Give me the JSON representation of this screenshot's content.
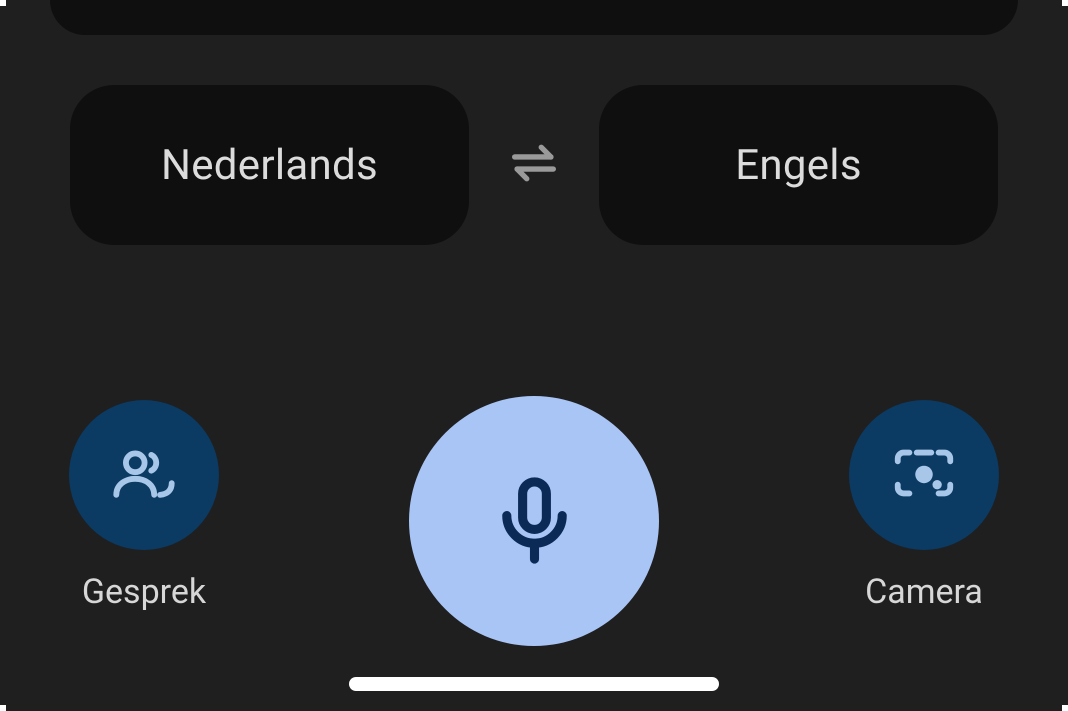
{
  "languages": {
    "source": "Nederlands",
    "target": "Engels"
  },
  "actions": {
    "conversation": "Gesprek",
    "camera": "Camera"
  },
  "icons": {
    "swap": "swap-horizontal-icon",
    "conversation": "people-icon",
    "mic": "microphone-icon",
    "camera": "camera-lens-icon"
  },
  "colors": {
    "background": "#1f1f1f",
    "card": "#0f0f0f",
    "actionCircle": "#0b3a63",
    "micButton": "#a9c5f5",
    "micIcon": "#0b2a55",
    "iconLight": "#a8c7e8"
  }
}
